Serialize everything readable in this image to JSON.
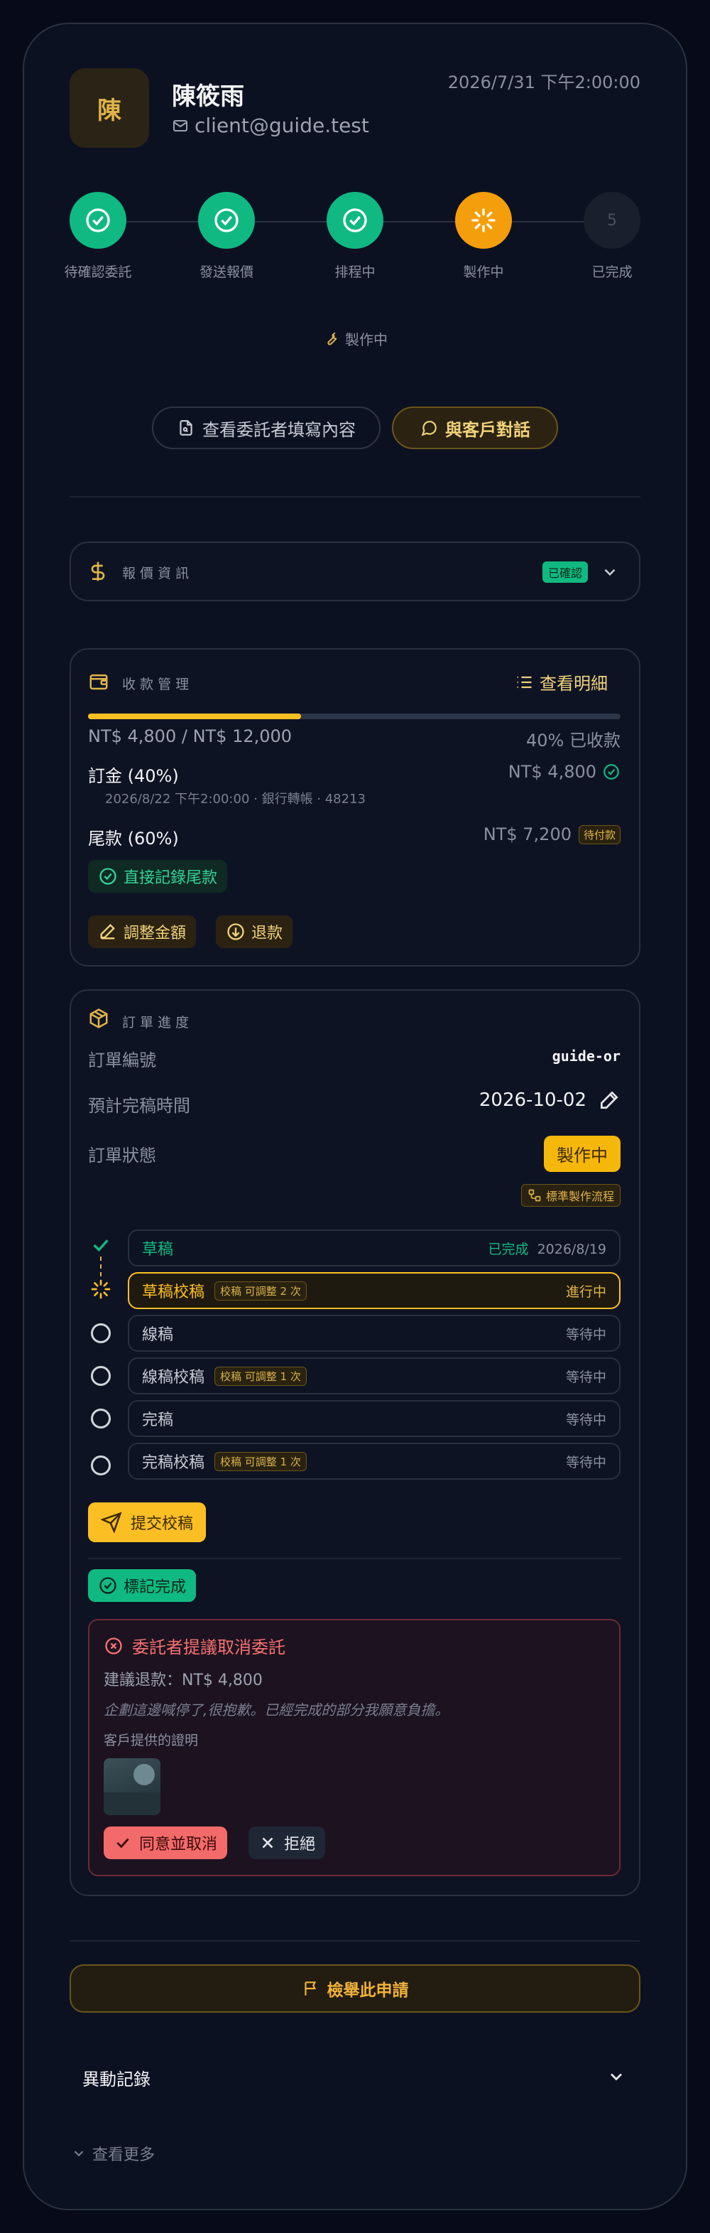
{
  "header": {
    "avatar_char": "陳",
    "name": "陳筱雨",
    "email": "client@guide.test",
    "datetime": "2026/7/31 下午2:00:00"
  },
  "stepper": {
    "steps": [
      {
        "label": "待確認委託",
        "state": "done"
      },
      {
        "label": "發送報價",
        "state": "done"
      },
      {
        "label": "排程中",
        "state": "done"
      },
      {
        "label": "製作中",
        "state": "current"
      },
      {
        "label": "已完成",
        "state": "pending",
        "num": "5"
      }
    ],
    "current_status": "製作中"
  },
  "actions": {
    "view_form": "查看委託者填寫內容",
    "chat": "與客戶對話"
  },
  "quote": {
    "title": "報 價 資 訊",
    "badge": "已確認"
  },
  "payment": {
    "title": "收 款 管 理",
    "view_detail": "查看明細",
    "progress_pct": 40,
    "amount_text": "NT$ 4,800 / NT$ 12,000",
    "pct_text": "40% 已收款",
    "deposit_label": "訂金 (40%)",
    "deposit_amount": "NT$ 4,800",
    "deposit_meta": "2026/8/22 下午2:00:00 · 銀行轉帳 · 48213",
    "final_label": "尾款 (60%)",
    "final_amount": "NT$ 7,200",
    "final_badge": "待付款",
    "record_final": "直接記錄尾款",
    "adjust": "調整金額",
    "refund": "退款"
  },
  "order": {
    "title": "訂 單 進 度",
    "number_label": "訂單編號",
    "number_value": "guide-or",
    "due_label": "預計完稿時間",
    "due_value": "2026-10-02",
    "status_label": "訂單狀態",
    "status_value": "製作中",
    "workflow": "標準製作流程",
    "stages": [
      {
        "name": "草稿",
        "state": "done",
        "status": "已完成",
        "date": "2026/8/19"
      },
      {
        "name": "草稿校稿",
        "state": "current",
        "tag": "校稿 可調整 2 次",
        "status": "進行中"
      },
      {
        "name": "線稿",
        "state": "pending",
        "status": "等待中"
      },
      {
        "name": "線稿校稿",
        "state": "pending",
        "tag": "校稿 可調整 1 次",
        "status": "等待中"
      },
      {
        "name": "完稿",
        "state": "pending",
        "status": "等待中"
      },
      {
        "name": "完稿校稿",
        "state": "pending",
        "tag": "校稿 可調整 1 次",
        "status": "等待中"
      }
    ],
    "submit": "提交校稿",
    "mark_done": "標記完成"
  },
  "cancel": {
    "title": "委託者提議取消委託",
    "refund": "建議退款：NT$ 4,800",
    "reason": "企劃這邊喊停了,很抱歉。已經完成的部分我願意負擔。",
    "proof_label": "客戶提供的證明",
    "agree": "同意並取消",
    "reject": "拒絕"
  },
  "report": "檢舉此申請",
  "history": {
    "title": "異動記錄",
    "more": "查看更多"
  },
  "colors": {
    "green": "#10b981",
    "amber": "#fbbf24",
    "orange": "#f59e0b",
    "red": "#f87171",
    "bg": "#070b19"
  }
}
